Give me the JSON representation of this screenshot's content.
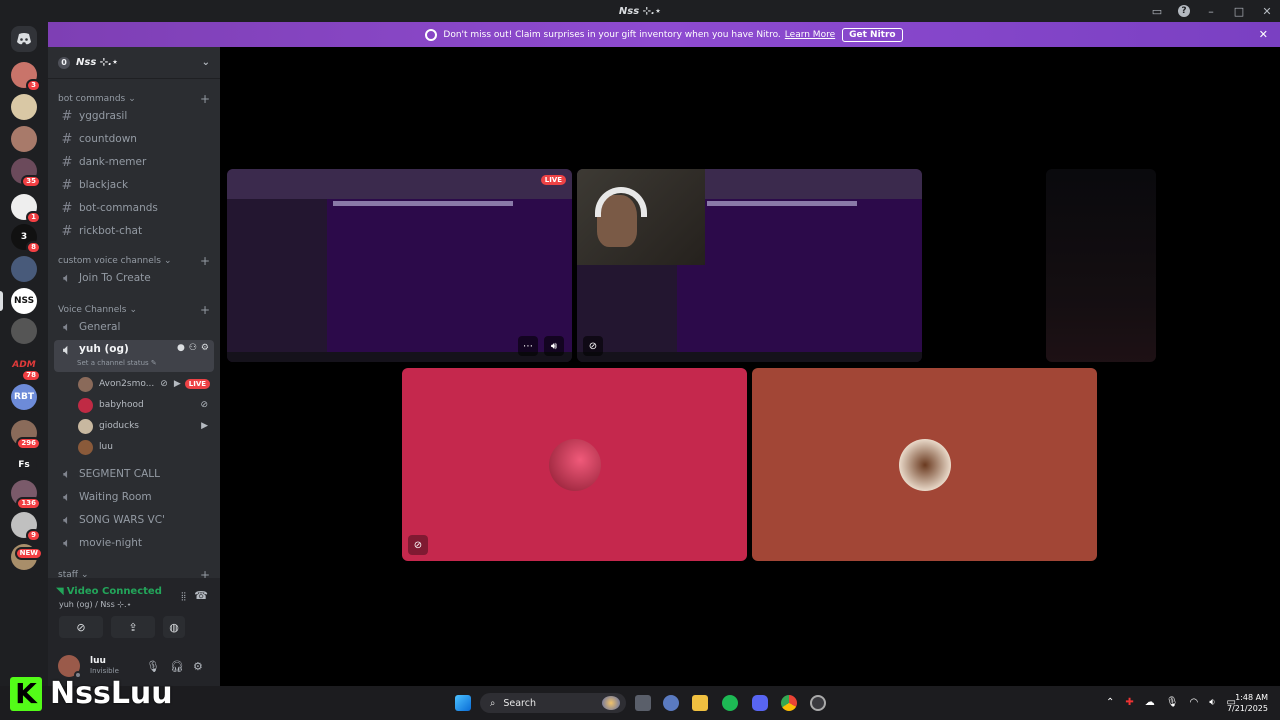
{
  "window": {
    "title": "Nss ⊹.⋆"
  },
  "banner": {
    "text": "Don't miss out! Claim surprises in your gift inventory when you have Nitro.",
    "link": "Learn More",
    "button": "Get Nitro"
  },
  "server": {
    "name": "Nss ⊹.⋆",
    "boost_level": "0"
  },
  "servers": [
    {
      "badge": "3",
      "color": "#c9746a"
    },
    {
      "badge": "",
      "color": "#d9c8a5"
    },
    {
      "badge": "",
      "color": "#a87a6a"
    },
    {
      "badge": "35",
      "color": "#6b4a5b"
    },
    {
      "badge": "1",
      "color": "#eeeeee"
    },
    {
      "badge": "8",
      "color": "#111111",
      "label": "3"
    },
    {
      "badge": "",
      "color": "#485a7a"
    },
    {
      "badge": "",
      "color": "#ffffff",
      "label": "NSS"
    },
    {
      "badge": "",
      "color": "#555555"
    },
    {
      "badge": "78",
      "color": "#1e1f22",
      "label": "ADM"
    },
    {
      "badge": "",
      "color": "#6d8bd8",
      "label": "RBT"
    },
    {
      "badge": "296",
      "color": "#8a6b5a"
    },
    {
      "badge": "",
      "color": "#1e1f22",
      "label": "Fs"
    },
    {
      "badge": "136",
      "color": "#7a5a6a"
    },
    {
      "badge": "9",
      "color": "#c0c0c0"
    },
    {
      "badge": "NEW",
      "color": "#a88e6a"
    }
  ],
  "categories": {
    "bot": "bot commands",
    "custom": "custom voice channels",
    "voice": "Voice Channels",
    "staff": "staff"
  },
  "text_channels": [
    "yggdrasil",
    "countdown",
    "dank-memer",
    "blackjack",
    "bot-commands",
    "rickbot-chat"
  ],
  "custom_voice": [
    "Join To Create"
  ],
  "voice_channels": {
    "general": "General",
    "active": "yuh (og)",
    "status_hint": "Set a channel status",
    "others": [
      "SEGMENT CALL",
      "Waiting Room",
      "SONG WARS VC'",
      "movie-night"
    ]
  },
  "members": [
    {
      "name": "Avon2smo...",
      "live": "LIVE",
      "color": "#8a6a5a"
    },
    {
      "name": "babyhood",
      "color": "#c02a44"
    },
    {
      "name": "gioducks",
      "color": "#c8b8a0"
    },
    {
      "name": "luu",
      "color": "#8a5a3a"
    }
  ],
  "voice_status": {
    "connected": "Video Connected",
    "location": "yuh (og) / Nss ⊹.⋆"
  },
  "user": {
    "name": "luu",
    "status": "Invisible"
  },
  "stage": {
    "live_label": "LIVE",
    "tiles": [
      {
        "color": "#c5284d"
      },
      {
        "color": "#a24636"
      }
    ]
  },
  "taskbar": {
    "search": "Search",
    "time": "1:48 AM",
    "date": "7/21/2025"
  },
  "watermark": {
    "k": "K",
    "name": "NssLuu"
  },
  "colors": {
    "accent": "#5865f2",
    "online": "#23a55a",
    "danger": "#ed4245",
    "nitro": "#8e4bd0"
  }
}
